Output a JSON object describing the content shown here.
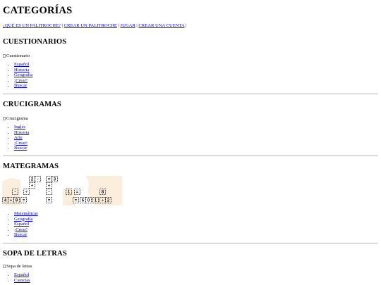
{
  "page": {
    "title": "CATEGORÍAS"
  },
  "topnav": {
    "items": [
      "¿QUÉ ES UN PALITROCHE?",
      "CREAR UN PALITROCHE",
      "JUGAR",
      "CREAR UNA CUENTA"
    ],
    "separator": "|"
  },
  "sections": [
    {
      "heading": "CUESTIONARIOS",
      "image_alt": "Cuestionario",
      "links": [
        "Español",
        "Historia",
        "Geografía",
        "¡Crear!",
        "Buscar"
      ]
    },
    {
      "heading": "CRUCIGRAMAS",
      "image_alt": "Crucigrama",
      "links": [
        "Inglés",
        "Historia",
        "Arte",
        "¡Crear!",
        "Buscar"
      ]
    },
    {
      "heading": "MATEGRAMAS",
      "links": [
        "Matemáticas",
        "Geografía",
        "Español",
        "¡Crear!",
        "Buscar"
      ]
    },
    {
      "heading": "SOPA DE LETRAS",
      "image_alt": "Sopa de letras",
      "links": [
        "Español",
        "Ciencias"
      ]
    }
  ],
  "mategrama_image": {
    "cells": [
      "2",
      "-",
      "=",
      "3",
      "+",
      "+",
      "-",
      "÷",
      "-",
      "1",
      "=",
      "8",
      "4",
      "+",
      "9",
      "=",
      "=",
      "=",
      "6",
      "0",
      "1",
      "÷",
      "2"
    ]
  },
  "colors": {
    "link": "#0000ee",
    "divider": "#b7b7b7",
    "mategrama_tint": "#fbeedc"
  }
}
